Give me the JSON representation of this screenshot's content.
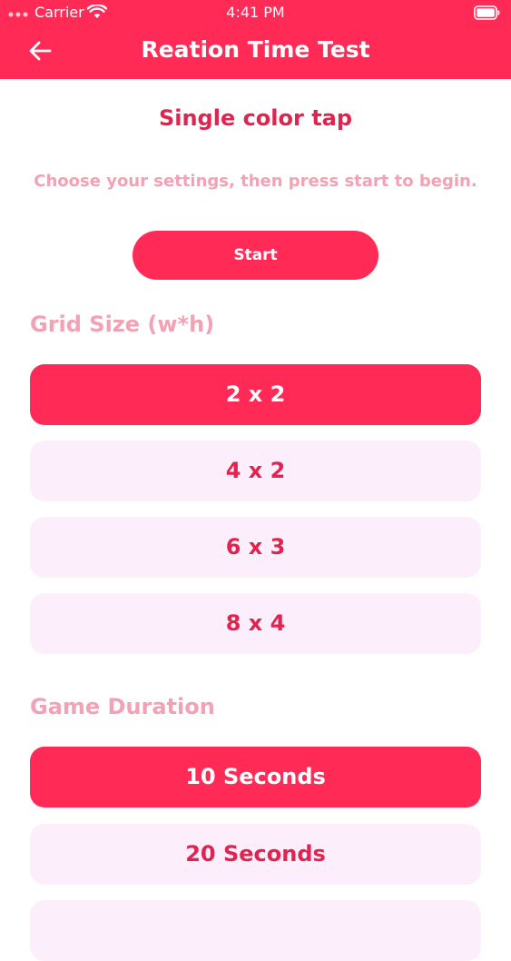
{
  "status_bar": {
    "carrier": "Carrier",
    "time": "4:41 PM"
  },
  "nav": {
    "title": "Reation Time Test",
    "back_icon": "arrow-left-icon"
  },
  "content": {
    "subtitle": "Single color tap",
    "instructions": "Choose your settings, then press start to begin.",
    "start_label": "Start"
  },
  "grid_size": {
    "label": "Grid Size (w*h)",
    "options": [
      "2 x 2",
      "4 x 2",
      "6 x 3",
      "8 x 4"
    ],
    "selected": "2 x 2"
  },
  "game_duration": {
    "label": "Game Duration",
    "options": [
      "10 Seconds",
      "20 Seconds"
    ],
    "selected": "10 Seconds"
  },
  "colors": {
    "accent": "#FF2A55",
    "accent_text": "#E0234F",
    "muted_pink_text": "#F2A2B4",
    "unselected_bg": "#FDEEFB"
  }
}
